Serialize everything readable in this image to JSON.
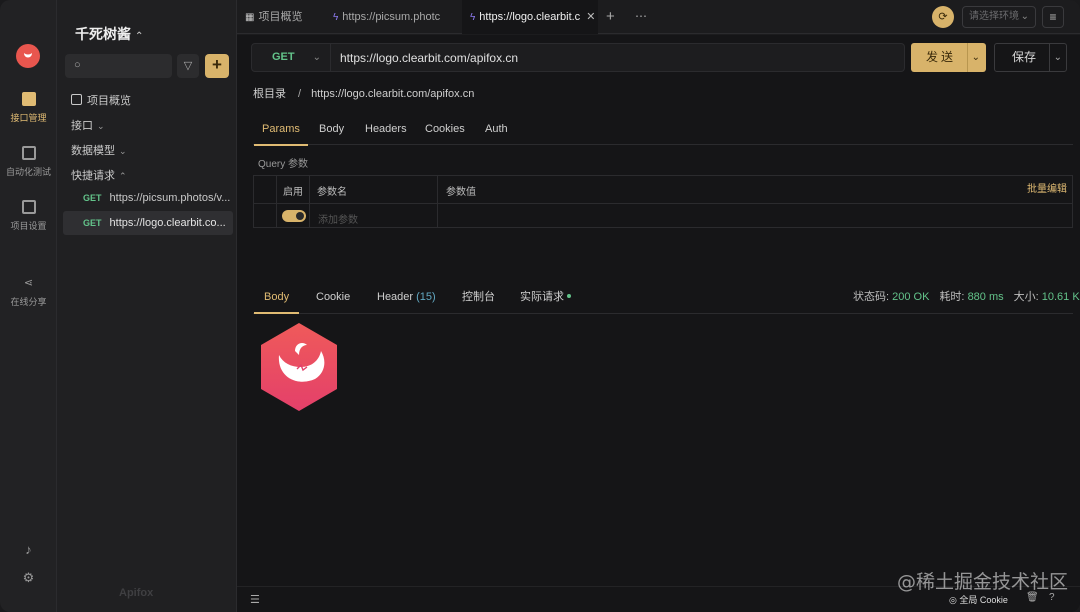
{
  "sidebar": {
    "project_name": "千死树酱",
    "search_placeholder": "",
    "tree": {
      "overview": "项目概览",
      "interfaces": "接口",
      "data_models": "数据模型",
      "quick_requests": "快捷请求"
    },
    "requests": [
      {
        "method": "GET",
        "url": "https://picsum.photos/v..."
      },
      {
        "method": "GET",
        "url": "https://logo.clearbit.co..."
      }
    ],
    "brand": "Apifox"
  },
  "rail": {
    "items": [
      {
        "label": "接口管理",
        "icon": "api-management-icon"
      },
      {
        "label": "自动化测试",
        "icon": "automated-test-icon"
      },
      {
        "label": "项目设置",
        "icon": "project-settings-icon"
      },
      {
        "label": "在线分享",
        "icon": "share-icon"
      }
    ]
  },
  "tabs": [
    {
      "label": "项目概览",
      "icon": "grid-icon"
    },
    {
      "label": "https://picsum.photc",
      "icon": "lightning-icon"
    },
    {
      "label": "https://logo.clearbit.c",
      "icon": "lightning-icon"
    }
  ],
  "env": {
    "placeholder": "请选择环境"
  },
  "request": {
    "method": "GET",
    "url": "https://logo.clearbit.com/apifox.cn",
    "send_label": "发送",
    "save_label": "保存",
    "breadcrumb_root": "根目录",
    "breadcrumb_sep": "/",
    "breadcrumb_current": "https://logo.clearbit.com/apifox.cn",
    "tabs": [
      "Params",
      "Body",
      "Headers",
      "Cookies",
      "Auth"
    ],
    "query_label": "Query 参数",
    "columns": {
      "enable": "启用",
      "name": "参数名",
      "value": "参数值"
    },
    "bulk_edit": "批量编辑",
    "add_param_placeholder": "添加参数"
  },
  "response": {
    "tabs": [
      "Body",
      "Cookie",
      "Header",
      "控制台",
      "实际请求"
    ],
    "header_count": "(15)",
    "status_label": "状态码:",
    "status_value": "200 OK",
    "time_label": "耗时:",
    "time_value": "880 ms",
    "size_label": "大小:",
    "size_value": "10.61 K"
  },
  "footer": {
    "cookie_label": "全局 Cookie"
  },
  "watermark": "@稀土掘金技术社区",
  "colors": {
    "accent": "#d8b36a",
    "get": "#63c38a",
    "logo": "#e8564e"
  }
}
